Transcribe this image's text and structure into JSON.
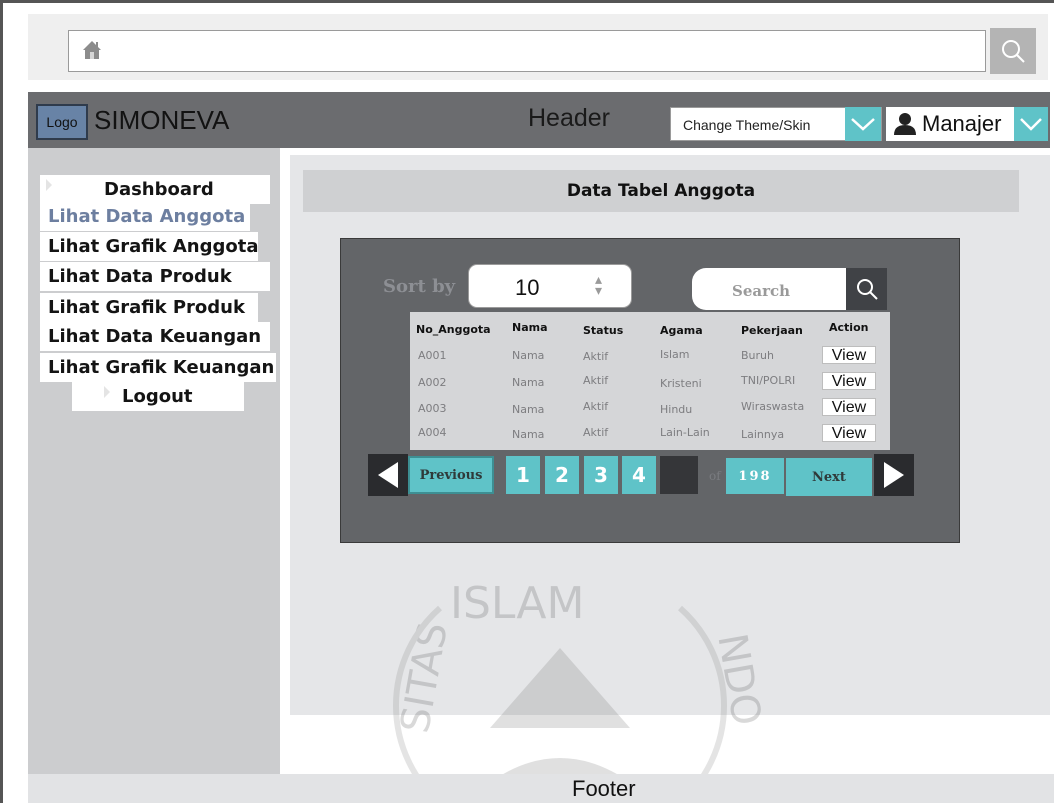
{
  "url_bar": {
    "value": "",
    "home_icon": "home-icon",
    "search_icon": "magnifier-icon"
  },
  "header": {
    "logo": "Logo",
    "app_name": "SIMONEVA",
    "title": "Header",
    "theme_select": "Change Theme/Skin",
    "user": "Manajer",
    "accent": "#5fc3c8",
    "bar_color": "#6b6c6f"
  },
  "sidebar": {
    "items": [
      {
        "label": "Dashboard",
        "active": false
      },
      {
        "label": "Lihat Data Anggota",
        "active": true
      },
      {
        "label": "Lihat Grafik Anggota",
        "active": false
      },
      {
        "label": "Lihat Data Produk",
        "active": false
      },
      {
        "label": "Lihat Grafik Produk",
        "active": false
      },
      {
        "label": "Lihat Data Keuangan",
        "active": false
      },
      {
        "label": "Lihat Grafik Keuangan",
        "active": false
      },
      {
        "label": "Logout",
        "active": false
      }
    ]
  },
  "main": {
    "title": "Data Tabel Anggota",
    "sort_label": "Sort by",
    "sort_value": "10",
    "search_placeholder": "Search",
    "columns": [
      "No_Anggota",
      "Nama",
      "Status",
      "Agama",
      "Pekerjaan",
      "Action"
    ],
    "rows": [
      {
        "no": "A001",
        "nama": "Nama",
        "status": "Aktif",
        "agama": "Islam",
        "pekerjaan": "Buruh",
        "action": "View"
      },
      {
        "no": "A002",
        "nama": "Nama",
        "status": "Aktif",
        "agama": "Kristeni",
        "pekerjaan": "TNI/POLRI",
        "action": "View"
      },
      {
        "no": "A003",
        "nama": "Nama",
        "status": "Aktif",
        "agama": "Hindu",
        "pekerjaan": "Wiraswasta",
        "action": "View"
      },
      {
        "no": "A004",
        "nama": "Nama",
        "status": "Aktif",
        "agama": "Lain-Lain",
        "pekerjaan": "Lainnya",
        "action": "View"
      }
    ],
    "pagination": {
      "previous": "Previous",
      "pages": [
        "1",
        "2",
        "3",
        "4"
      ],
      "current_input": "",
      "of": "of",
      "total": "198",
      "next": "Next"
    }
  },
  "watermark": {
    "text_top": "ISLAM",
    "text_left": "SITAS",
    "text_right": "NDO"
  },
  "footer": {
    "label": "Footer"
  }
}
